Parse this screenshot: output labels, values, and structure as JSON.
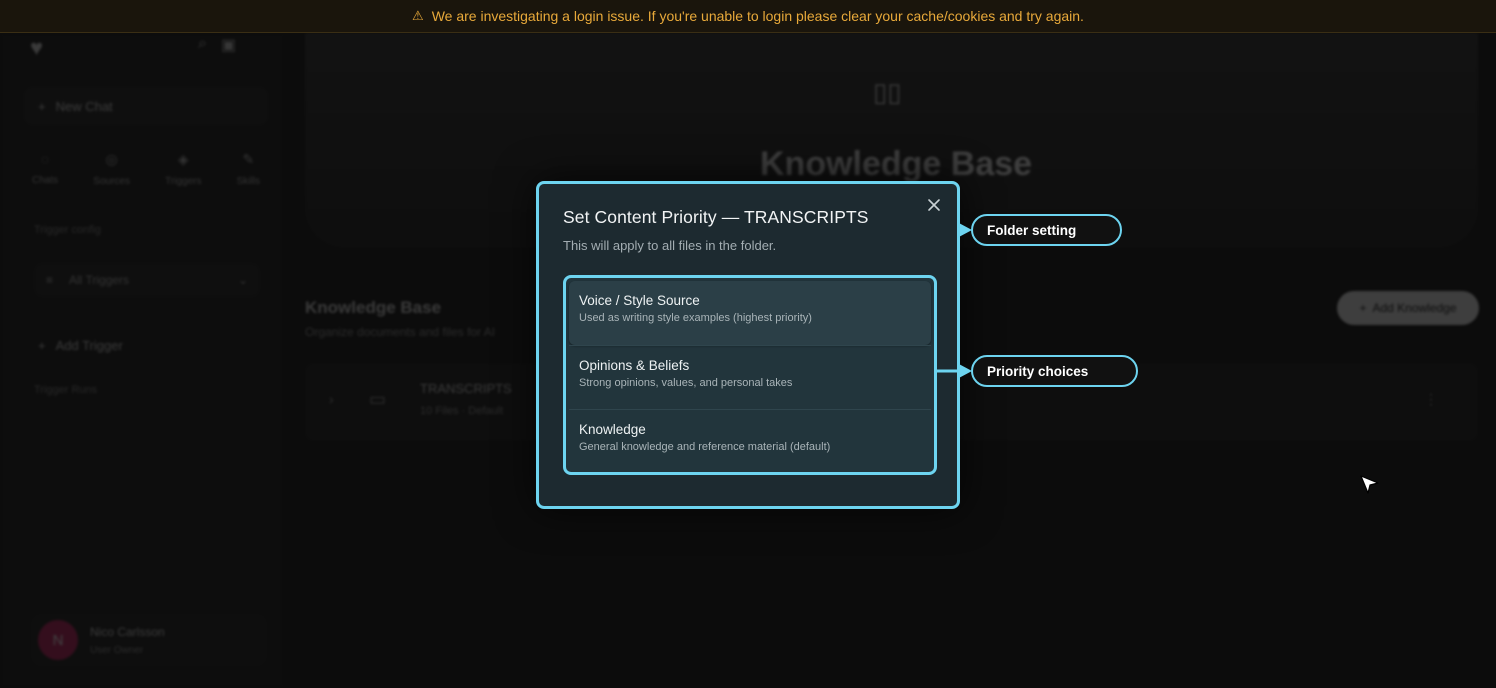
{
  "banner": {
    "icon": "warning-icon",
    "text": "We are investigating a login issue. If you're unable to login please clear your cache/cookies and try again."
  },
  "dialog": {
    "title": "Set Content Priority — TRANSCRIPTS",
    "subtitle": "This will apply to all files in the folder.",
    "close_icon": "close-icon",
    "options": [
      {
        "title": "Voice / Style Source",
        "description": "Used as writing style examples (highest priority)",
        "selected": true
      },
      {
        "title": "Opinions & Beliefs",
        "description": "Strong opinions, values, and personal takes",
        "selected": false
      },
      {
        "title": "Knowledge",
        "description": "General knowledge and reference material (default)",
        "selected": false
      }
    ]
  },
  "callouts": {
    "folder_setting": "Folder setting",
    "priority_choices": "Priority choices"
  },
  "background": {
    "sidebar": {
      "new_chat": "New Chat",
      "tabs": [
        "Chats",
        "Sources",
        "Triggers",
        "Skills"
      ],
      "trigger_config_label": "Trigger config",
      "all_triggers": "All Triggers",
      "add_trigger": "Add Trigger",
      "trigger_runs_label": "Trigger Runs",
      "user": {
        "initial": "N",
        "name": "Nico Carlsson",
        "plan": "User Owner"
      }
    },
    "hero_title": "Knowledge Base",
    "kb": {
      "title": "Knowledge Base",
      "subtitle": "Organize documents and files for AI",
      "add_button": "Add Knowledge",
      "folder_name": "TRANSCRIPTS",
      "folder_meta": "10 Files · Default"
    }
  },
  "colors": {
    "accent": "#6dd4f0",
    "banner_text": "#e8a93a",
    "dialog_bg": "#1d2a30"
  }
}
